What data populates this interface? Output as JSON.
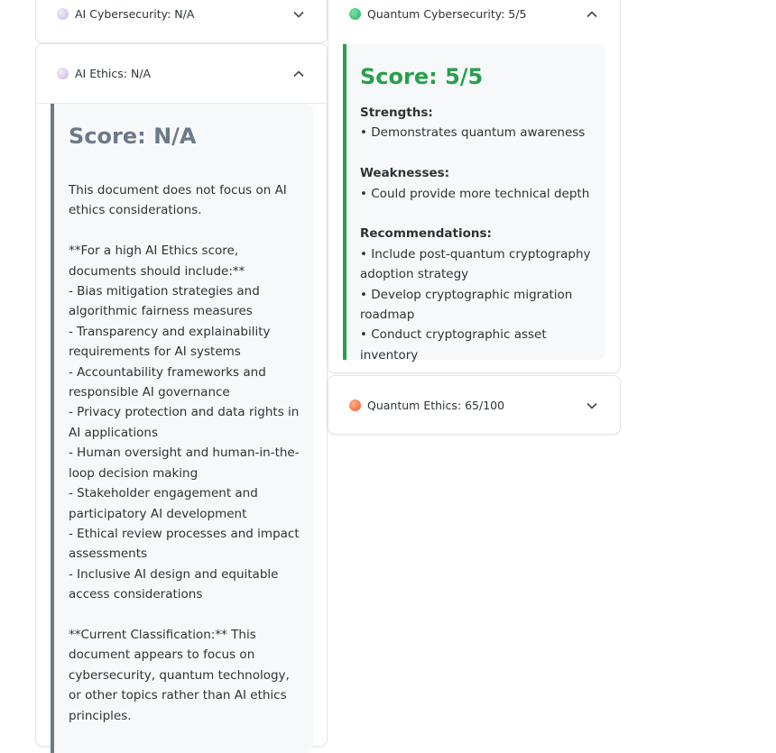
{
  "colors": {
    "na_gray": "#6c7a89",
    "green": "#27a04a",
    "lavender_dot": "#d6c8ec",
    "green_dot": "#2ecc71",
    "orange_dot": "#f0703c"
  },
  "left": {
    "cyber": {
      "title": "AI Cybersecurity: N/A",
      "icon": "chevron-down-icon"
    },
    "ethics": {
      "title": "AI Ethics: N/A",
      "icon": "chevron-up-icon",
      "score": "Score: N/A",
      "body": "This document does not focus on AI ethics considerations.\n\n**For a high AI Ethics score, documents should include:**\n- Bias mitigation strategies and algorithmic fairness measures\n- Transparency and explainability requirements for AI systems\n- Accountability frameworks and responsible AI governance\n- Privacy protection and data rights in AI applications\n- Human oversight and human-in-the-loop decision making\n- Stakeholder engagement and participatory AI development\n- Ethical review processes and impact assessments\n- Inclusive AI design and equitable access considerations\n\n**Current Classification:** This document appears to focus on cybersecurity, quantum technology, or other topics rather than AI ethics principles."
    }
  },
  "right": {
    "qcyber": {
      "title": "Quantum Cybersecurity: 5/5",
      "icon": "chevron-up-icon",
      "score": "Score: 5/5",
      "strengths_label": "Strengths:",
      "strengths": [
        "• Demonstrates quantum awareness"
      ],
      "weaknesses_label": "Weaknesses:",
      "weaknesses": [
        "• Could provide more technical depth"
      ],
      "recommendations_label": "Recommendations:",
      "recommendations": [
        "• Include post-quantum cryptography adoption strategy",
        "• Develop cryptographic migration roadmap",
        "• Conduct cryptographic asset inventory"
      ]
    },
    "qethics": {
      "title": "Quantum Ethics: 65/100",
      "icon": "chevron-down-icon"
    }
  }
}
